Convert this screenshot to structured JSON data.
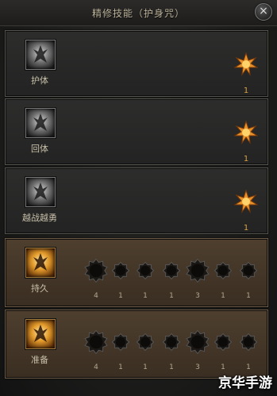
{
  "window": {
    "title": "精修技能（护身咒）",
    "close_icon": "close-icon",
    "close_label": "×"
  },
  "skills": [
    {
      "name": "护体",
      "count": "1",
      "icon": "warrior-icon"
    },
    {
      "name": "回体",
      "count": "1",
      "icon": "warrior-icon"
    },
    {
      "name": "越战越勇",
      "count": "1",
      "icon": "warrior-icon"
    }
  ],
  "trees": [
    {
      "name": "持久",
      "icon": "warrior-gold-icon",
      "nodes": [
        "4",
        "1",
        "1",
        "1",
        "3",
        "1",
        "1"
      ]
    },
    {
      "name": "准备",
      "icon": "warrior-gold-icon",
      "nodes": [
        "4",
        "1",
        "1",
        "1",
        "3",
        "1",
        "1"
      ]
    }
  ],
  "watermark": "京华手游",
  "colors": {
    "accent": "#d7a142",
    "active_panel": "#4a3c2c"
  }
}
